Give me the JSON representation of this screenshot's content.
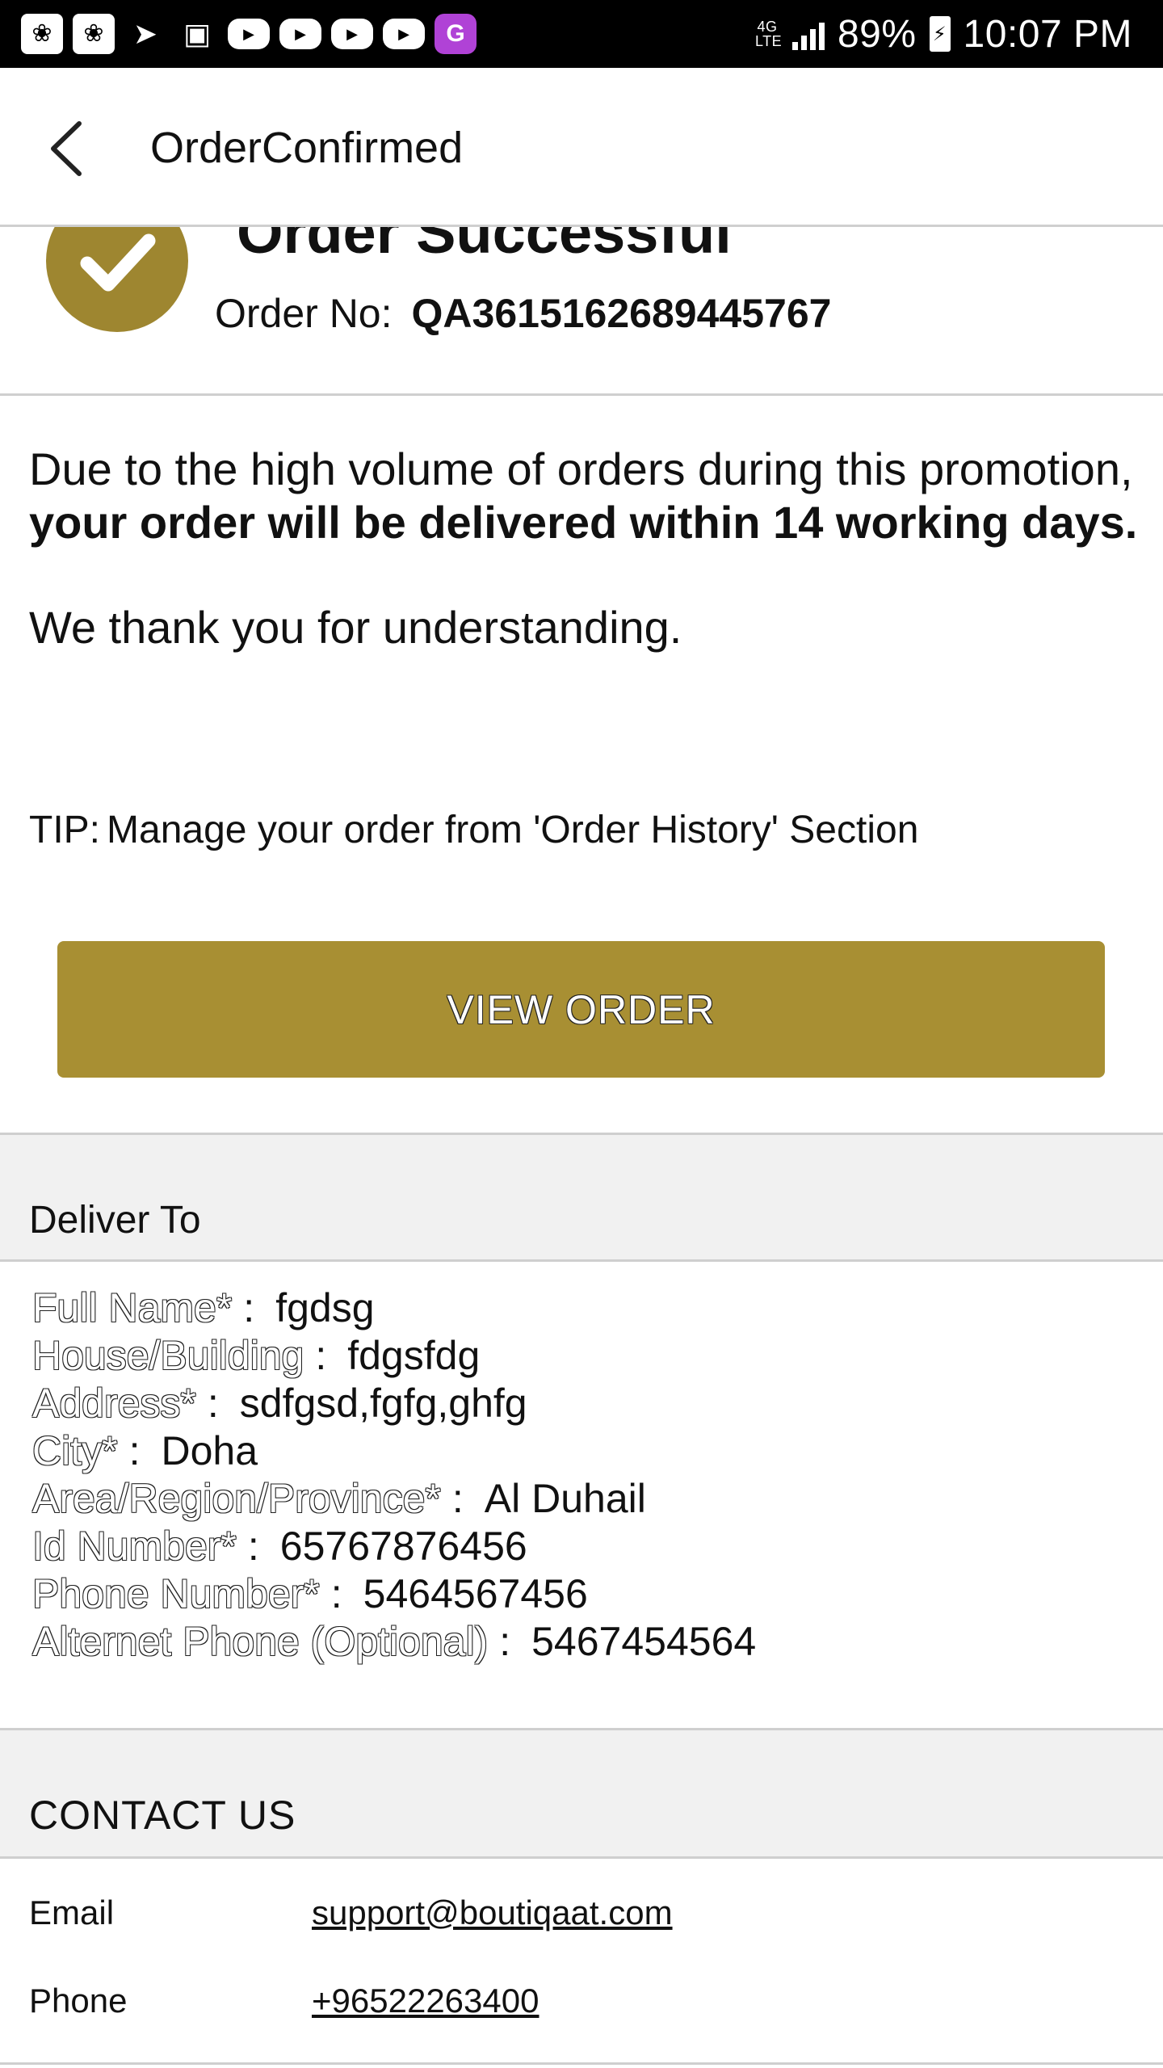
{
  "status_bar": {
    "network": "4G LTE",
    "battery": "89%",
    "time": "10:07 PM"
  },
  "app_bar": {
    "back_icon": "chevron-left-icon",
    "title": "OrderConfirmed"
  },
  "order_result": {
    "title": "Order Successful",
    "order_no_label": "Order No:",
    "order_no_value": "QA3615162689445767"
  },
  "notice": {
    "line1": "Due to the high volume of orders during this promotion,",
    "line2": "your order will be delivered within 14 working days.",
    "line3": "We thank you for understanding."
  },
  "tip": {
    "label": "TIP:",
    "text": "Manage your order from 'Order History' Section"
  },
  "view_order_button": "VIEW ORDER",
  "deliver_to": {
    "heading": "Deliver To",
    "separator": ":",
    "fields": [
      {
        "label": "Full Name*",
        "value": "fgdsg"
      },
      {
        "label": "House/Building",
        "value": "fdgsfdg"
      },
      {
        "label": "Address*",
        "value": "sdfgsd,fgfg,ghfg"
      },
      {
        "label": "City*",
        "value": "Doha"
      },
      {
        "label": "Area/Region/Province*",
        "value": "Al Duhail"
      },
      {
        "label": "Id Number*",
        "value": "65767876456"
      },
      {
        "label": "Phone Number*",
        "value": "5464567456"
      },
      {
        "label": "Alternet Phone (Optional)",
        "value": "5467454564"
      }
    ]
  },
  "contact_us": {
    "heading": "CONTACT US",
    "email_label": "Email",
    "email_value": "support@boutiqaat.com",
    "phone_label": "Phone",
    "phone_value": "+96522263400"
  },
  "colors": {
    "accent_gold": "#a88f33",
    "check_circle": "#9e8630",
    "section_bg": "#f1f1f1"
  }
}
